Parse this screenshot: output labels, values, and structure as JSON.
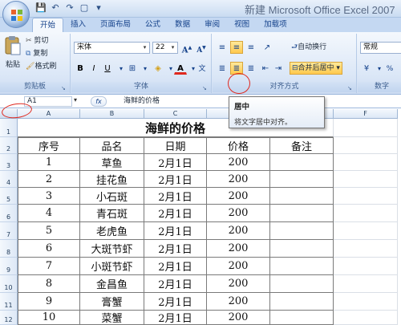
{
  "window": {
    "title": "新建 Microsoft Office Excel 2007"
  },
  "tabs": [
    "开始",
    "插入",
    "页面布局",
    "公式",
    "数据",
    "审阅",
    "视图",
    "加载项"
  ],
  "clipboard": {
    "paste": "粘贴",
    "cut": "剪切",
    "copy": "复制",
    "format_painter": "格式刷",
    "label": "剪贴板"
  },
  "font": {
    "name": "宋体",
    "size": "22",
    "grow": "A",
    "shrink": "A",
    "bold": "B",
    "italic": "I",
    "underline": "U",
    "label": "字体"
  },
  "alignment": {
    "wrap": "自动换行",
    "merge": "合并后居中",
    "label": "对齐方式"
  },
  "number": {
    "format": "常规",
    "percent": "%",
    "label": "数字"
  },
  "formula_bar": {
    "name_box": "A1",
    "fx": "fx",
    "content": "海鲜的价格"
  },
  "tooltip": {
    "title": "居中",
    "description": "将文字居中对齐。"
  },
  "sheet": {
    "title": "海鲜的价格",
    "columns": [
      "A",
      "B",
      "C",
      "D",
      "E",
      "F"
    ],
    "row_numbers": [
      "1",
      "2",
      "3",
      "4",
      "5",
      "6",
      "7",
      "8",
      "9",
      "10",
      "11",
      "12"
    ],
    "headers": [
      "序号",
      "品名",
      "日期",
      "价格",
      "备注"
    ],
    "rows": [
      [
        "1",
        "草鱼",
        "2月1日",
        "200",
        ""
      ],
      [
        "2",
        "挂花鱼",
        "2月1日",
        "200",
        ""
      ],
      [
        "3",
        "小石斑",
        "2月1日",
        "200",
        ""
      ],
      [
        "4",
        "青石斑",
        "2月1日",
        "200",
        ""
      ],
      [
        "5",
        "老虎鱼",
        "2月1日",
        "200",
        ""
      ],
      [
        "6",
        "大斑节虾",
        "2月1日",
        "200",
        ""
      ],
      [
        "7",
        "小斑节虾",
        "2月1日",
        "200",
        ""
      ],
      [
        "8",
        "金昌鱼",
        "2月1日",
        "200",
        ""
      ],
      [
        "9",
        "膏蟹",
        "2月1日",
        "200",
        ""
      ],
      [
        "10",
        "菜蟹",
        "2月1日",
        "200",
        ""
      ]
    ]
  },
  "colors": {
    "annotation": "#e0281e",
    "selected_button": "#ffc94d",
    "ribbon": "#dbe7f7"
  }
}
